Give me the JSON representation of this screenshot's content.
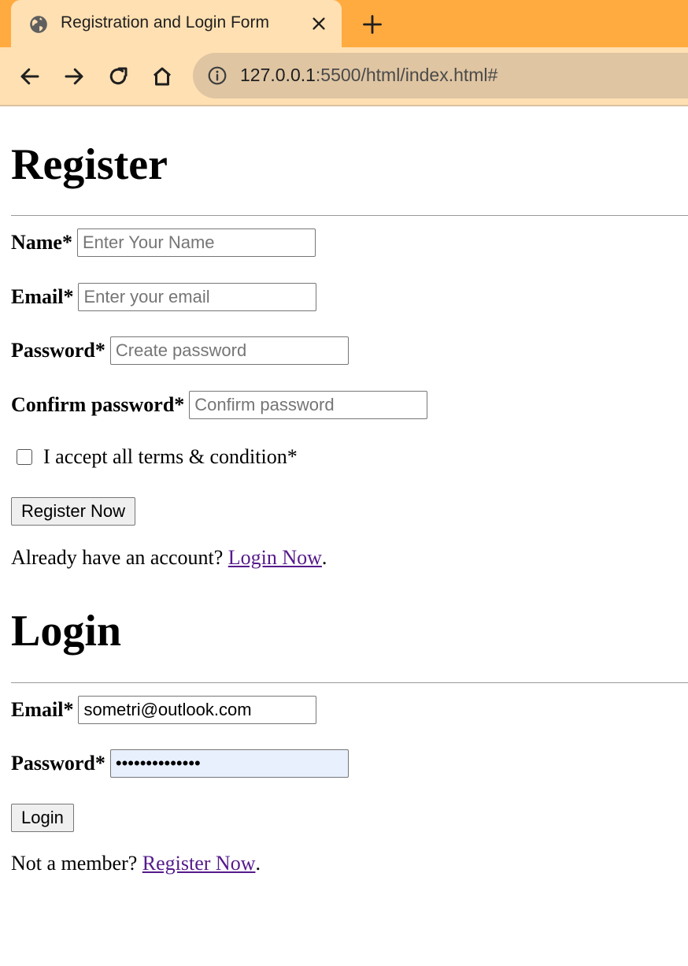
{
  "browser": {
    "tab_title": "Registration and Login Form",
    "url_host": "127.0.0.1",
    "url_rest": ":5500/html/index.html#",
    "accent_color": "#ffab40",
    "tab_color": "#ffe0b2"
  },
  "register": {
    "heading": "Register",
    "name": {
      "label": "Name*",
      "placeholder": "Enter Your Name",
      "value": ""
    },
    "email": {
      "label": "Email*",
      "placeholder": "Enter your email",
      "value": ""
    },
    "password": {
      "label": "Password*",
      "placeholder": "Create password",
      "value": ""
    },
    "confirm": {
      "label": "Confirm password*",
      "placeholder": "Confirm password",
      "value": ""
    },
    "terms_label": "I accept all terms & condition*",
    "terms_checked": false,
    "submit_label": "Register Now",
    "footer_text": "Already have an account? ",
    "footer_link": "Login Now",
    "footer_end": "."
  },
  "login": {
    "heading": "Login",
    "email": {
      "label": "Email*",
      "value": "sometri@outlook.com"
    },
    "password": {
      "label": "Password*",
      "value": "••••••••••••••"
    },
    "submit_label": "Login",
    "footer_text": "Not a member? ",
    "footer_link": "Register Now",
    "footer_end": "."
  }
}
